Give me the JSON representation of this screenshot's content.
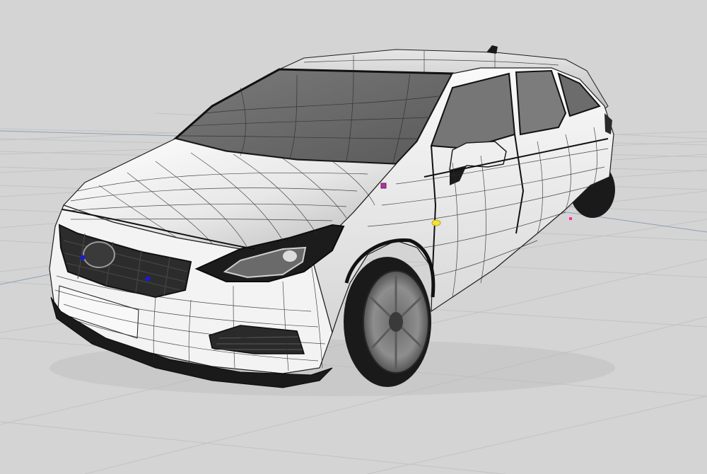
{
  "viewport": {
    "background_color": "#d4d4d4",
    "grid_color": "#c2c2c2",
    "axis_color": "#8f9fb8"
  },
  "model": {
    "wireframe_color": "#1e1e1e",
    "body_color": "#f2f2f2",
    "glass_color": "#6e6e6e",
    "tire_color": "#1a1a1a",
    "rim_color": "#888888"
  },
  "markers": [
    {
      "name": "vertex-marker-magenta",
      "color": "#b0359a"
    },
    {
      "name": "vertex-marker-blue-1",
      "color": "#1a1adb"
    },
    {
      "name": "vertex-marker-blue-2",
      "color": "#1a1adb"
    },
    {
      "name": "vertex-marker-yellow",
      "color": "#f2e23a"
    },
    {
      "name": "vertex-marker-pink",
      "color": "#ff2aa0"
    }
  ]
}
